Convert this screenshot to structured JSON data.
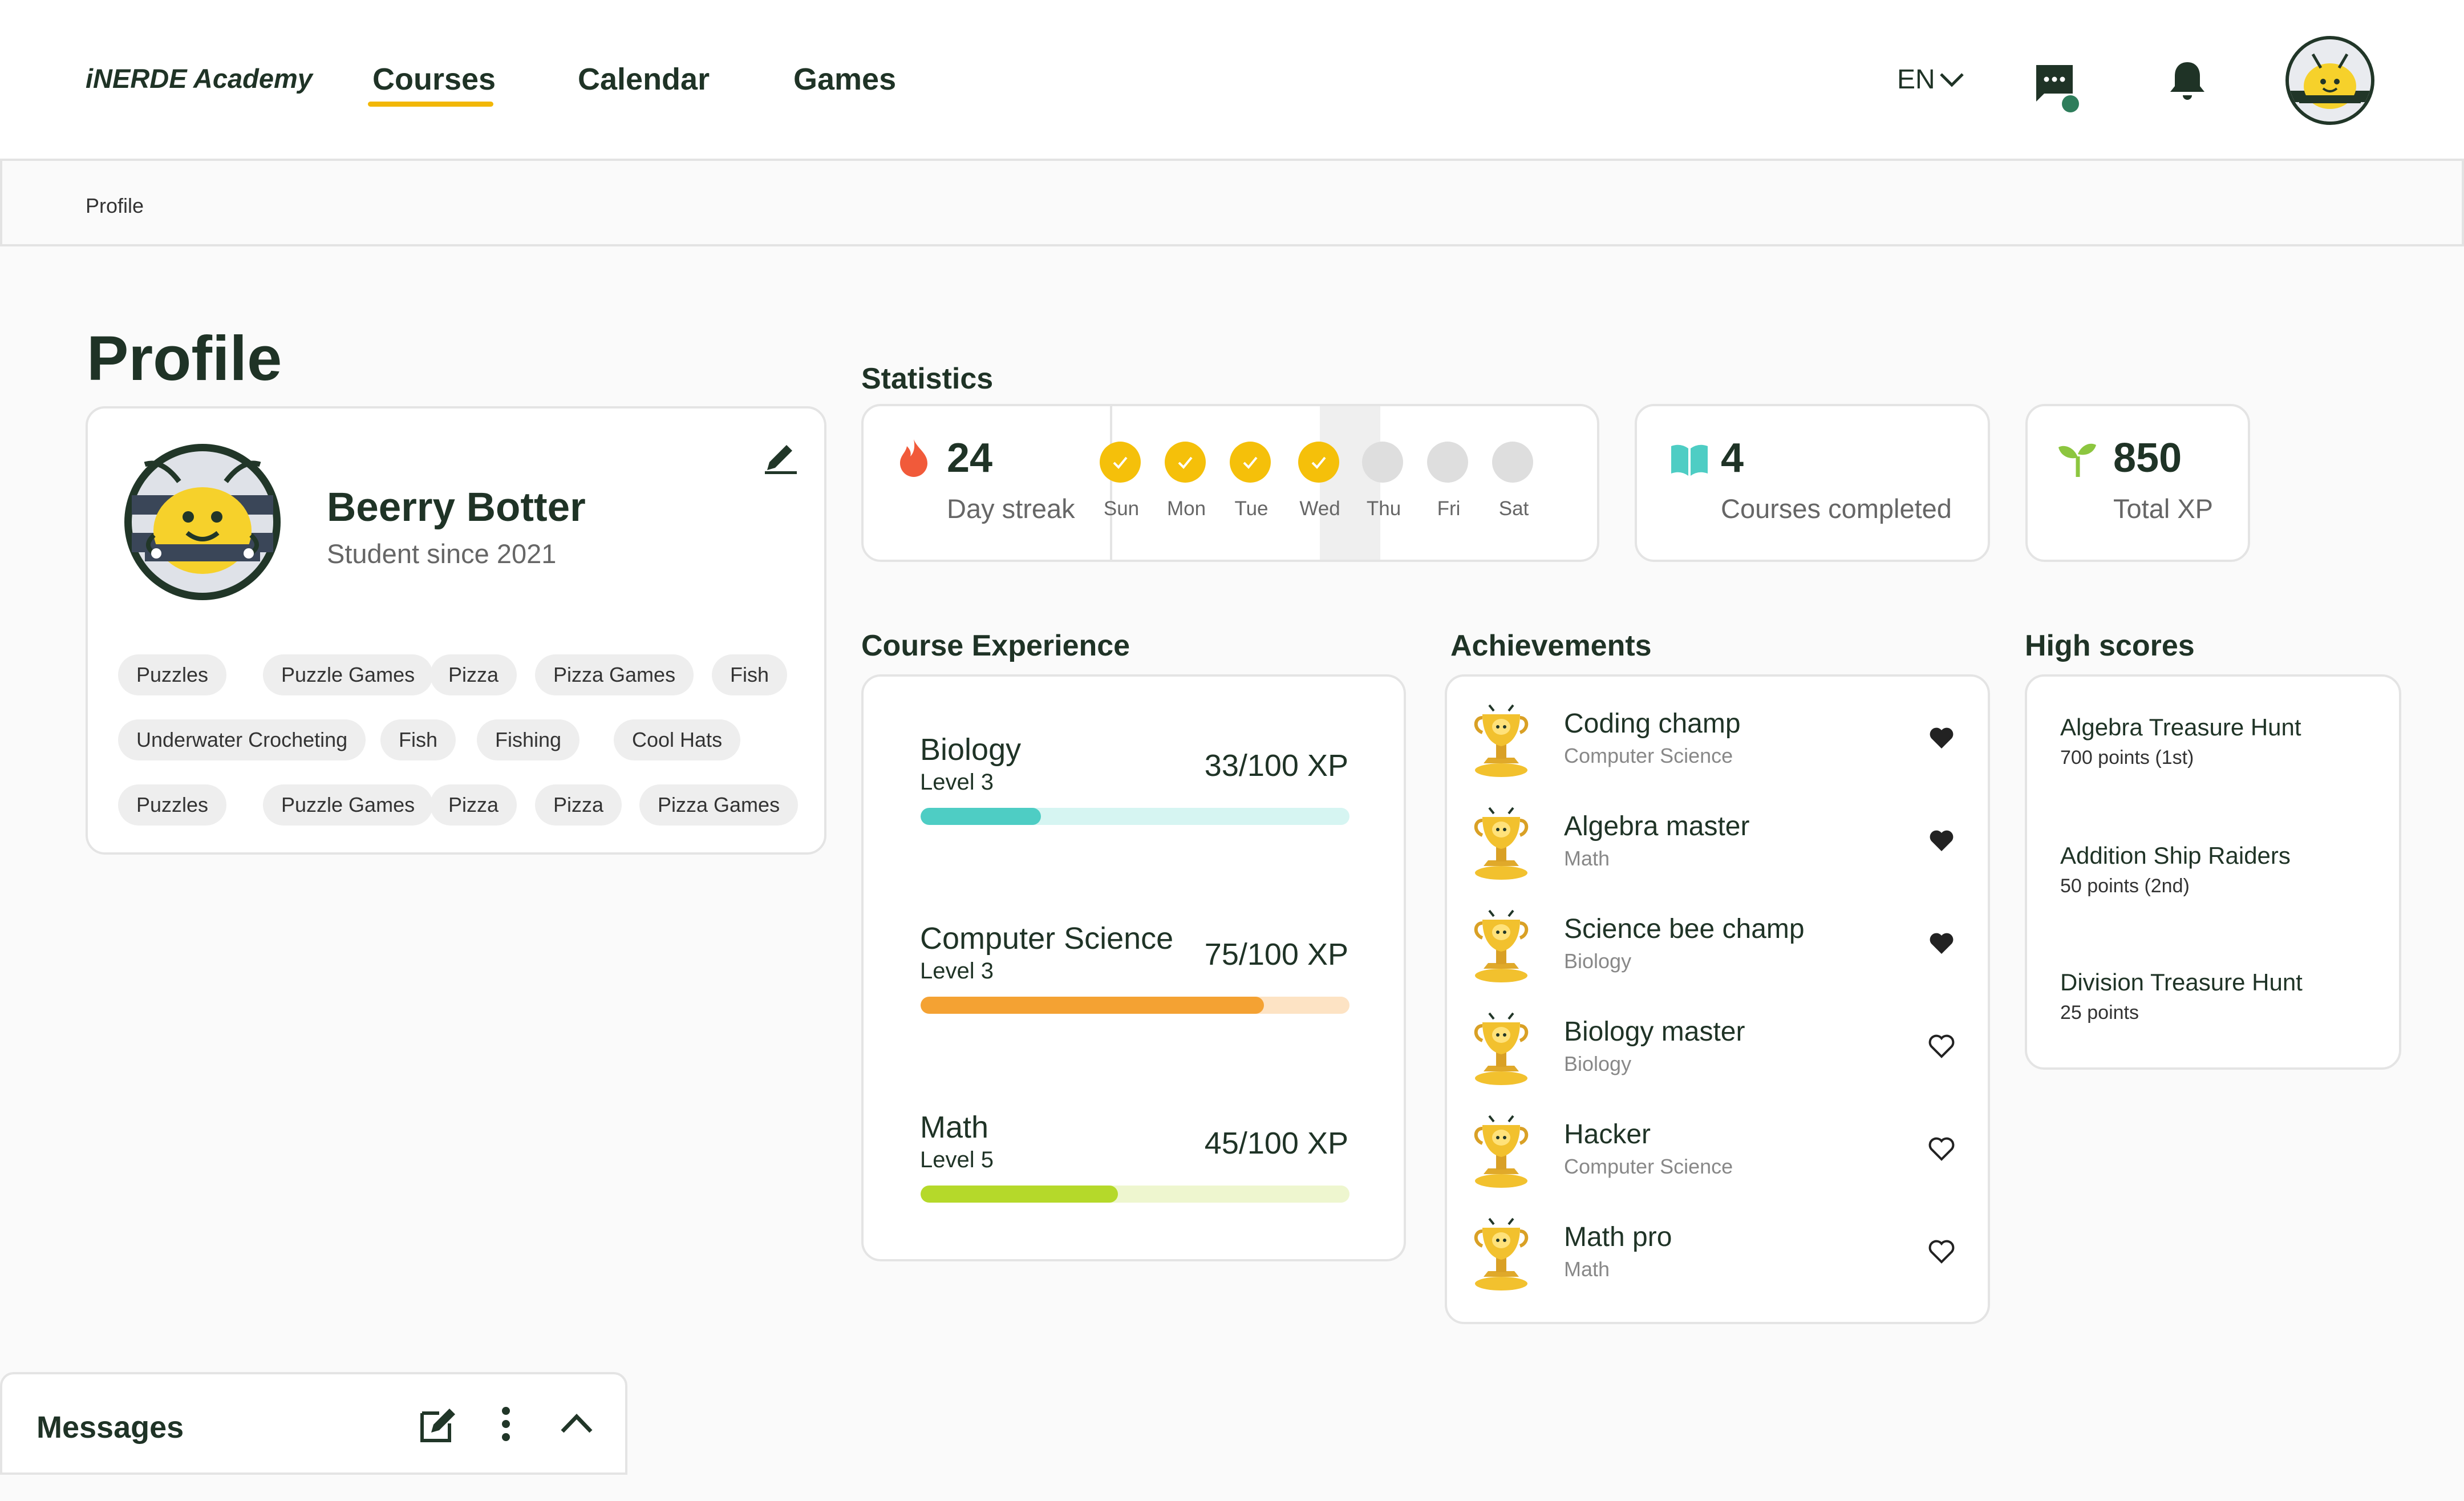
{
  "header": {
    "brand": "iNERDE Academy",
    "nav": [
      "Courses",
      "Calendar",
      "Games"
    ],
    "active_nav": "Courses",
    "language": "EN",
    "accent_color": "#f2b707"
  },
  "breadcrumb": "Profile",
  "page_title": "Profile",
  "profile": {
    "name": "Beerry Botter",
    "since": "Student since 2021",
    "tags": [
      [
        "Puzzles",
        "Puzzle Games",
        "Pizza",
        "Pizza Games",
        "Fish"
      ],
      [
        "Underwater Crocheting",
        "Fish",
        "Fishing",
        "Cool Hats"
      ],
      [
        "Puzzles",
        "Puzzle Games",
        "Pizza",
        "Pizza",
        "Pizza Games"
      ]
    ]
  },
  "statistics": {
    "title": "Statistics",
    "streak": {
      "value": "24",
      "label": "Day streak"
    },
    "days": [
      {
        "label": "Sun",
        "done": true
      },
      {
        "label": "Mon",
        "done": true
      },
      {
        "label": "Tue",
        "done": true
      },
      {
        "label": "Wed",
        "done": true,
        "today": true
      },
      {
        "label": "Thu",
        "done": false
      },
      {
        "label": "Fri",
        "done": false
      },
      {
        "label": "Sat",
        "done": false
      }
    ],
    "courses": {
      "value": "4",
      "label": "Courses completed"
    },
    "xp": {
      "value": "850",
      "label": "Total XP"
    }
  },
  "course_experience": {
    "title": "Course Experience",
    "courses": [
      {
        "name": "Biology",
        "level": "Level 3",
        "xp": "33/100 XP",
        "progress": 0.28,
        "fill": "#4ecdc4",
        "track": "#d6f5f2"
      },
      {
        "name": "Computer Science",
        "level": "Level 3",
        "xp": "75/100 XP",
        "progress": 0.8,
        "fill": "#f4a233",
        "track": "#fde3c4"
      },
      {
        "name": "Math",
        "level": "Level 5",
        "xp": "45/100 XP",
        "progress": 0.46,
        "fill": "#b5d92a",
        "track": "#eef6cf"
      }
    ]
  },
  "achievements": {
    "title": "Achievements",
    "items": [
      {
        "title": "Coding champ",
        "subject": "Computer Science",
        "liked": true
      },
      {
        "title": "Algebra master",
        "subject": "Math",
        "liked": true
      },
      {
        "title": "Science bee champ",
        "subject": "Biology",
        "liked": true
      },
      {
        "title": "Biology master",
        "subject": "Biology",
        "liked": false
      },
      {
        "title": "Hacker",
        "subject": "Computer Science",
        "liked": false
      },
      {
        "title": "Math pro",
        "subject": "Math",
        "liked": false
      }
    ]
  },
  "high_scores": {
    "title": "High scores",
    "items": [
      {
        "game": "Algebra Treasure Hunt",
        "score": "700 points (1st)"
      },
      {
        "game": "Addition Ship Raiders",
        "score": "50 points (2nd)"
      },
      {
        "game": "Division Treasure Hunt",
        "score": "25 points"
      }
    ]
  },
  "messages": {
    "title": "Messages"
  }
}
